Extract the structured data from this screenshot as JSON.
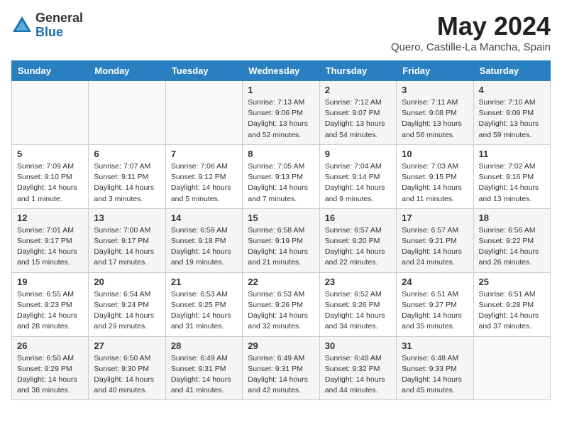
{
  "logo": {
    "general": "General",
    "blue": "Blue"
  },
  "title": "May 2024",
  "subtitle": "Quero, Castille-La Mancha, Spain",
  "days_of_week": [
    "Sunday",
    "Monday",
    "Tuesday",
    "Wednesday",
    "Thursday",
    "Friday",
    "Saturday"
  ],
  "weeks": [
    [
      {
        "day": "",
        "sunrise": "",
        "sunset": "",
        "daylight": ""
      },
      {
        "day": "",
        "sunrise": "",
        "sunset": "",
        "daylight": ""
      },
      {
        "day": "",
        "sunrise": "",
        "sunset": "",
        "daylight": ""
      },
      {
        "day": "1",
        "sunrise": "Sunrise: 7:13 AM",
        "sunset": "Sunset: 9:06 PM",
        "daylight": "Daylight: 13 hours and 52 minutes."
      },
      {
        "day": "2",
        "sunrise": "Sunrise: 7:12 AM",
        "sunset": "Sunset: 9:07 PM",
        "daylight": "Daylight: 13 hours and 54 minutes."
      },
      {
        "day": "3",
        "sunrise": "Sunrise: 7:11 AM",
        "sunset": "Sunset: 9:08 PM",
        "daylight": "Daylight: 13 hours and 56 minutes."
      },
      {
        "day": "4",
        "sunrise": "Sunrise: 7:10 AM",
        "sunset": "Sunset: 9:09 PM",
        "daylight": "Daylight: 13 hours and 59 minutes."
      }
    ],
    [
      {
        "day": "5",
        "sunrise": "Sunrise: 7:09 AM",
        "sunset": "Sunset: 9:10 PM",
        "daylight": "Daylight: 14 hours and 1 minute."
      },
      {
        "day": "6",
        "sunrise": "Sunrise: 7:07 AM",
        "sunset": "Sunset: 9:11 PM",
        "daylight": "Daylight: 14 hours and 3 minutes."
      },
      {
        "day": "7",
        "sunrise": "Sunrise: 7:06 AM",
        "sunset": "Sunset: 9:12 PM",
        "daylight": "Daylight: 14 hours and 5 minutes."
      },
      {
        "day": "8",
        "sunrise": "Sunrise: 7:05 AM",
        "sunset": "Sunset: 9:13 PM",
        "daylight": "Daylight: 14 hours and 7 minutes."
      },
      {
        "day": "9",
        "sunrise": "Sunrise: 7:04 AM",
        "sunset": "Sunset: 9:14 PM",
        "daylight": "Daylight: 14 hours and 9 minutes."
      },
      {
        "day": "10",
        "sunrise": "Sunrise: 7:03 AM",
        "sunset": "Sunset: 9:15 PM",
        "daylight": "Daylight: 14 hours and 11 minutes."
      },
      {
        "day": "11",
        "sunrise": "Sunrise: 7:02 AM",
        "sunset": "Sunset: 9:16 PM",
        "daylight": "Daylight: 14 hours and 13 minutes."
      }
    ],
    [
      {
        "day": "12",
        "sunrise": "Sunrise: 7:01 AM",
        "sunset": "Sunset: 9:17 PM",
        "daylight": "Daylight: 14 hours and 15 minutes."
      },
      {
        "day": "13",
        "sunrise": "Sunrise: 7:00 AM",
        "sunset": "Sunset: 9:17 PM",
        "daylight": "Daylight: 14 hours and 17 minutes."
      },
      {
        "day": "14",
        "sunrise": "Sunrise: 6:59 AM",
        "sunset": "Sunset: 9:18 PM",
        "daylight": "Daylight: 14 hours and 19 minutes."
      },
      {
        "day": "15",
        "sunrise": "Sunrise: 6:58 AM",
        "sunset": "Sunset: 9:19 PM",
        "daylight": "Daylight: 14 hours and 21 minutes."
      },
      {
        "day": "16",
        "sunrise": "Sunrise: 6:57 AM",
        "sunset": "Sunset: 9:20 PM",
        "daylight": "Daylight: 14 hours and 22 minutes."
      },
      {
        "day": "17",
        "sunrise": "Sunrise: 6:57 AM",
        "sunset": "Sunset: 9:21 PM",
        "daylight": "Daylight: 14 hours and 24 minutes."
      },
      {
        "day": "18",
        "sunrise": "Sunrise: 6:56 AM",
        "sunset": "Sunset: 9:22 PM",
        "daylight": "Daylight: 14 hours and 26 minutes."
      }
    ],
    [
      {
        "day": "19",
        "sunrise": "Sunrise: 6:55 AM",
        "sunset": "Sunset: 9:23 PM",
        "daylight": "Daylight: 14 hours and 28 minutes."
      },
      {
        "day": "20",
        "sunrise": "Sunrise: 6:54 AM",
        "sunset": "Sunset: 9:24 PM",
        "daylight": "Daylight: 14 hours and 29 minutes."
      },
      {
        "day": "21",
        "sunrise": "Sunrise: 6:53 AM",
        "sunset": "Sunset: 9:25 PM",
        "daylight": "Daylight: 14 hours and 31 minutes."
      },
      {
        "day": "22",
        "sunrise": "Sunrise: 6:53 AM",
        "sunset": "Sunset: 9:26 PM",
        "daylight": "Daylight: 14 hours and 32 minutes."
      },
      {
        "day": "23",
        "sunrise": "Sunrise: 6:52 AM",
        "sunset": "Sunset: 9:26 PM",
        "daylight": "Daylight: 14 hours and 34 minutes."
      },
      {
        "day": "24",
        "sunrise": "Sunrise: 6:51 AM",
        "sunset": "Sunset: 9:27 PM",
        "daylight": "Daylight: 14 hours and 35 minutes."
      },
      {
        "day": "25",
        "sunrise": "Sunrise: 6:51 AM",
        "sunset": "Sunset: 9:28 PM",
        "daylight": "Daylight: 14 hours and 37 minutes."
      }
    ],
    [
      {
        "day": "26",
        "sunrise": "Sunrise: 6:50 AM",
        "sunset": "Sunset: 9:29 PM",
        "daylight": "Daylight: 14 hours and 38 minutes."
      },
      {
        "day": "27",
        "sunrise": "Sunrise: 6:50 AM",
        "sunset": "Sunset: 9:30 PM",
        "daylight": "Daylight: 14 hours and 40 minutes."
      },
      {
        "day": "28",
        "sunrise": "Sunrise: 6:49 AM",
        "sunset": "Sunset: 9:31 PM",
        "daylight": "Daylight: 14 hours and 41 minutes."
      },
      {
        "day": "29",
        "sunrise": "Sunrise: 6:49 AM",
        "sunset": "Sunset: 9:31 PM",
        "daylight": "Daylight: 14 hours and 42 minutes."
      },
      {
        "day": "30",
        "sunrise": "Sunrise: 6:48 AM",
        "sunset": "Sunset: 9:32 PM",
        "daylight": "Daylight: 14 hours and 44 minutes."
      },
      {
        "day": "31",
        "sunrise": "Sunrise: 6:48 AM",
        "sunset": "Sunset: 9:33 PM",
        "daylight": "Daylight: 14 hours and 45 minutes."
      },
      {
        "day": "",
        "sunrise": "",
        "sunset": "",
        "daylight": ""
      }
    ]
  ]
}
